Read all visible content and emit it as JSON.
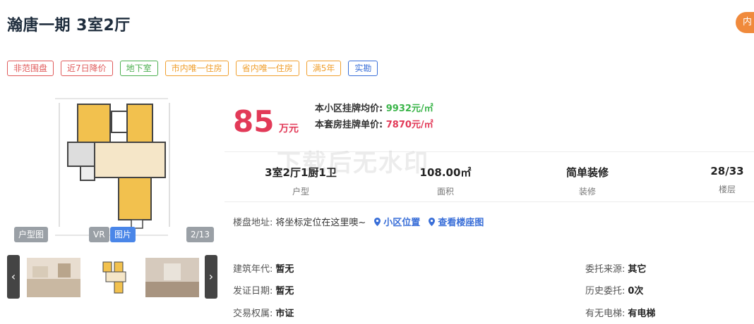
{
  "title": "瀚唐一期 3室2厅",
  "header_button": "内",
  "tags": [
    {
      "label": "非范围盘",
      "color": "#e05a5a"
    },
    {
      "label": "近7日降价",
      "color": "#e05a5a"
    },
    {
      "label": "地下室",
      "color": "#4caf50"
    },
    {
      "label": "市内唯一住房",
      "color": "#f0a030"
    },
    {
      "label": "省内唯一住房",
      "color": "#f0a030"
    },
    {
      "label": "满5年",
      "color": "#f0a030"
    },
    {
      "label": "实勘",
      "color": "#3a6fd8"
    }
  ],
  "viewer": {
    "floorplan_label": "户型图",
    "vr_label": "VR",
    "photo_label": "图片",
    "counter": "2/13"
  },
  "thumbnails": {
    "prev_icon": "chevron-left-icon",
    "next_icon": "chevron-right-icon"
  },
  "price": {
    "total": "85",
    "unit": "万元",
    "community_avg_label": "本小区挂牌均价:",
    "community_avg_value": "9932元/㎡",
    "unit_price_label": "本套房挂牌单价:",
    "unit_price_value": "7870元/㎡"
  },
  "stats": [
    {
      "value": "3室2厅1厨1卫",
      "key": "户型"
    },
    {
      "value": "108.00㎡",
      "key": "面积"
    },
    {
      "value": "简单装修",
      "key": "装修"
    },
    {
      "value": "28/33",
      "key": "楼层"
    }
  ],
  "address": {
    "label": "楼盘地址:",
    "value": "将坐标定位在这里噢~",
    "link1": "小区位置",
    "link2": "查看楼座图"
  },
  "info": {
    "build_year_label": "建筑年代:",
    "build_year_value": "暂无",
    "cert_date_label": "发证日期:",
    "cert_date_value": "暂无",
    "ownership_label": "交易权属:",
    "ownership_value": "市证",
    "source_label": "委托来源:",
    "source_value": "其它",
    "history_label": "历史委托:",
    "history_value": "0次",
    "elevator_label": "有无电梯:",
    "elevator_value": "有电梯"
  },
  "watermark": "下载后无水印"
}
